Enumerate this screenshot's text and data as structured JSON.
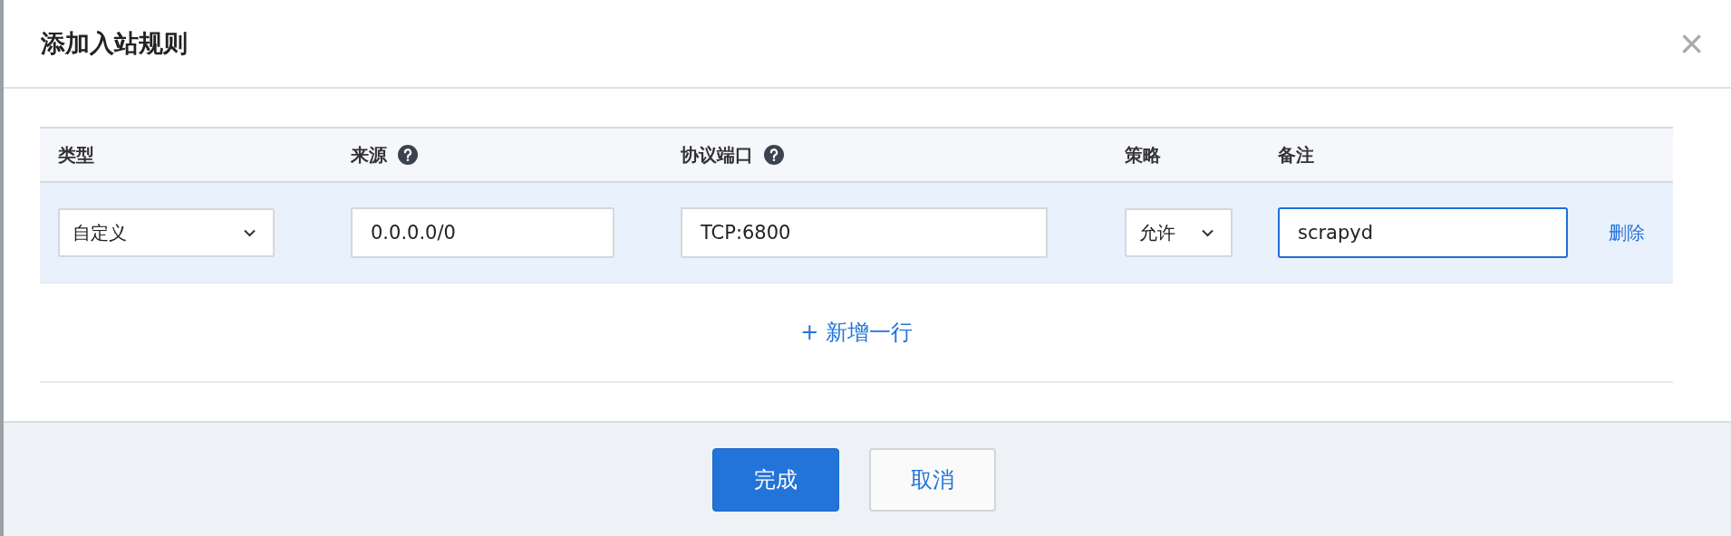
{
  "dialog": {
    "title": "添加入站规则",
    "close": "×"
  },
  "table": {
    "columns": [
      {
        "label": "类型"
      },
      {
        "label": "来源",
        "help": true
      },
      {
        "label": "协议端口",
        "help": true
      },
      {
        "label": "策略"
      },
      {
        "label": "备注"
      }
    ],
    "rows": [
      {
        "cells": [
          {
            "kind": "select",
            "value": "自定义"
          },
          {
            "kind": "input",
            "value": "0.0.0.0/0"
          },
          {
            "kind": "input",
            "value": "TCP:6800"
          },
          {
            "kind": "select",
            "value": "允许"
          },
          {
            "kind": "input",
            "value": "scrapyd",
            "focused": true
          }
        ],
        "action": "删除"
      }
    ],
    "add_row": "+ 新增一行"
  },
  "buttons": [
    {
      "label": "完成",
      "kind": "primary"
    },
    {
      "label": "取消",
      "kind": "secondary"
    }
  ]
}
